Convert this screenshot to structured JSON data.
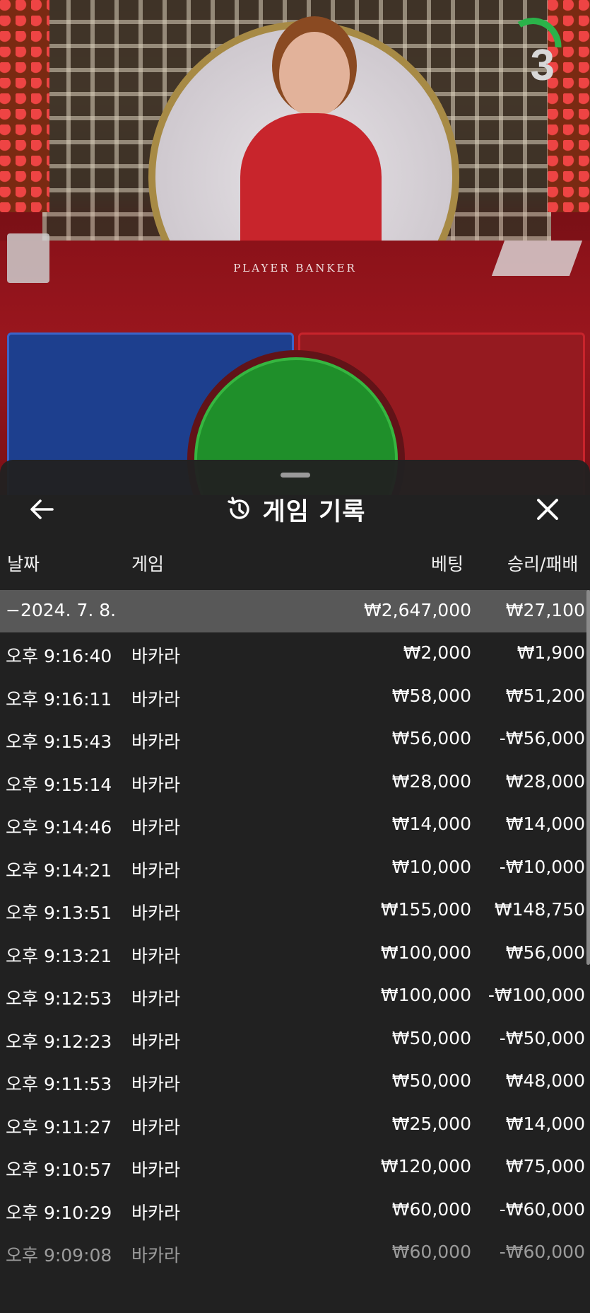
{
  "scene": {
    "table_label": "PLAYER      BANKER",
    "timer": "3"
  },
  "panel": {
    "title": "게임 기록",
    "columns": {
      "date": "날짜",
      "game": "게임",
      "bet": "베팅",
      "result": "승리/패배"
    },
    "summary": {
      "date": "−2024. 7. 8.",
      "bet": "₩2,647,000",
      "result": "₩27,100"
    },
    "rows": [
      {
        "time": "오후 9:16:40",
        "game": "바카라",
        "bet": "₩2,000",
        "result": "₩1,900"
      },
      {
        "time": "오후 9:16:11",
        "game": "바카라",
        "bet": "₩58,000",
        "result": "₩51,200"
      },
      {
        "time": "오후 9:15:43",
        "game": "바카라",
        "bet": "₩56,000",
        "result": "-₩56,000"
      },
      {
        "time": "오후 9:15:14",
        "game": "바카라",
        "bet": "₩28,000",
        "result": "₩28,000"
      },
      {
        "time": "오후 9:14:46",
        "game": "바카라",
        "bet": "₩14,000",
        "result": "₩14,000"
      },
      {
        "time": "오후 9:14:21",
        "game": "바카라",
        "bet": "₩10,000",
        "result": "-₩10,000"
      },
      {
        "time": "오후 9:13:51",
        "game": "바카라",
        "bet": "₩155,000",
        "result": "₩148,750"
      },
      {
        "time": "오후 9:13:21",
        "game": "바카라",
        "bet": "₩100,000",
        "result": "₩56,000"
      },
      {
        "time": "오후 9:12:53",
        "game": "바카라",
        "bet": "₩100,000",
        "result": "-₩100,000"
      },
      {
        "time": "오후 9:12:23",
        "game": "바카라",
        "bet": "₩50,000",
        "result": "-₩50,000"
      },
      {
        "time": "오후 9:11:53",
        "game": "바카라",
        "bet": "₩50,000",
        "result": "₩48,000"
      },
      {
        "time": "오후 9:11:27",
        "game": "바카라",
        "bet": "₩25,000",
        "result": "₩14,000"
      },
      {
        "time": "오후 9:10:57",
        "game": "바카라",
        "bet": "₩120,000",
        "result": "₩75,000"
      },
      {
        "time": "오후 9:10:29",
        "game": "바카라",
        "bet": "₩60,000",
        "result": "-₩60,000"
      },
      {
        "time": "오후 9:09:08",
        "game": "바카라",
        "bet": "₩60,000",
        "result": "-₩60,000"
      }
    ]
  },
  "icons": {
    "back": "arrow-left-icon",
    "history": "history-icon",
    "close": "close-icon"
  },
  "colors": {
    "panel_bg": "#212121",
    "summary_row_bg": "#585858",
    "timer_arc": "#2bb34a",
    "tie_zone": "#1f8f2a",
    "player_zone": "#1d3f8e",
    "banker_zone": "#951a20"
  }
}
